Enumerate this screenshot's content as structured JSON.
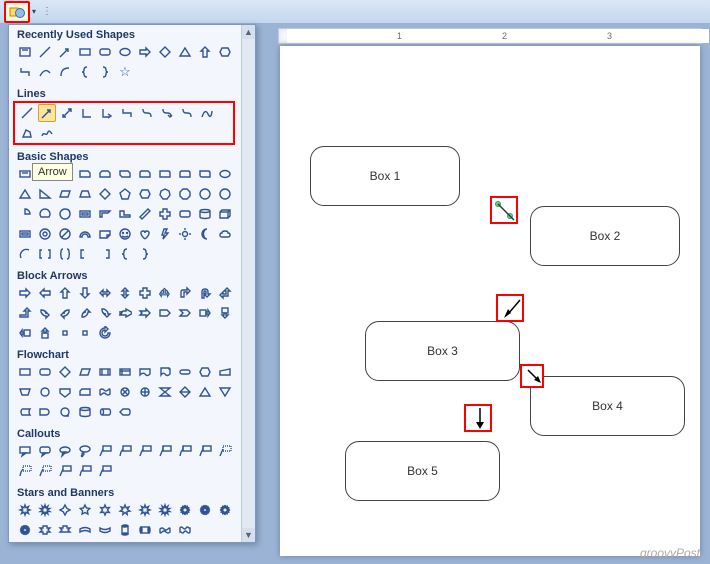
{
  "qat": {
    "shapes_button": "shapes",
    "dropdown": "▾"
  },
  "tooltip": "Arrow",
  "ruler": {
    "marks": [
      "1",
      "2",
      "3"
    ]
  },
  "categories": {
    "recently_used": {
      "label": "Recently Used Shapes"
    },
    "lines": {
      "label": "Lines"
    },
    "basic_shapes": {
      "label": "Basic Shapes"
    },
    "block_arrows": {
      "label": "Block Arrows"
    },
    "flowchart": {
      "label": "Flowchart"
    },
    "callouts": {
      "label": "Callouts"
    },
    "stars_banners": {
      "label": "Stars and Banners"
    }
  },
  "boxes": {
    "b1": "Box 1",
    "b2": "Box 2",
    "b3": "Box 3",
    "b4": "Box 4",
    "b5": "Box 5"
  },
  "watermark": "groovyPost"
}
